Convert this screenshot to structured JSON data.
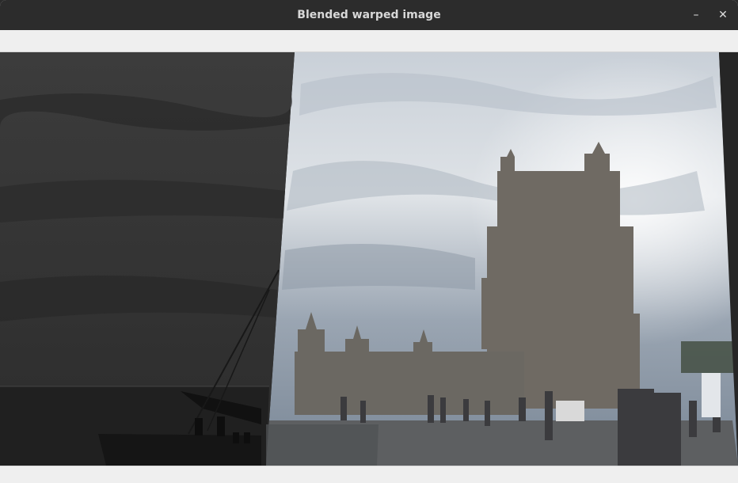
{
  "window": {
    "title": "Blended warped image",
    "minimize_glyph": "–",
    "close_glyph": "✕"
  },
  "icons": {
    "minimize": "minimize-icon",
    "close": "close-icon"
  },
  "colors": {
    "titlebar": "#2c2c2c",
    "title_text": "#d8d8d8",
    "chrome": "#efefef"
  }
}
